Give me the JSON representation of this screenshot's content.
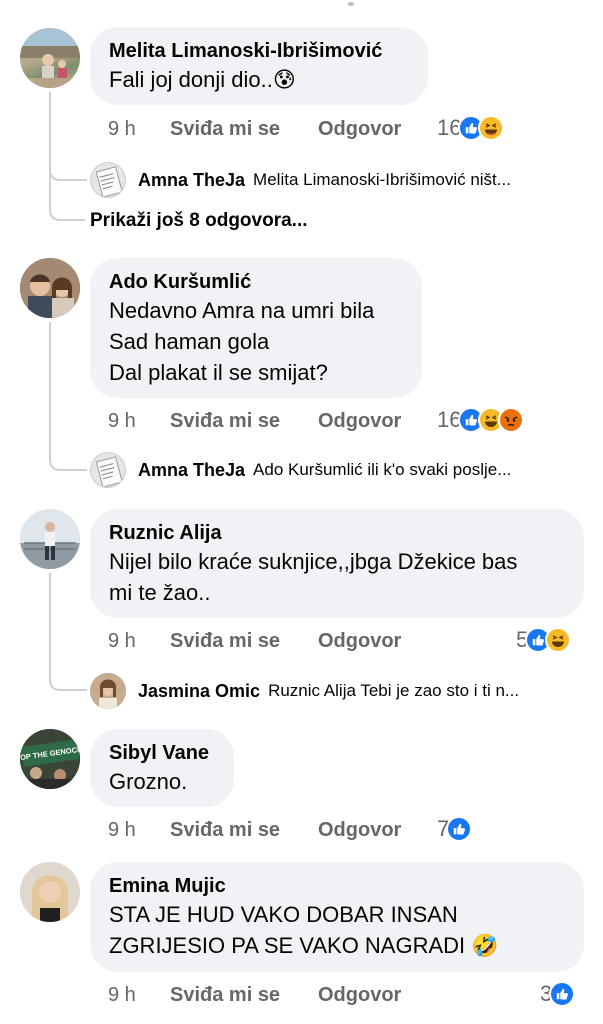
{
  "comments": [
    {
      "author": "Melita Limanoski-Ibrišimović",
      "text": "Fali joj donji dio..",
      "time": "9 h",
      "like_label": "Sviđa mi se",
      "reply_label": "Odgovor",
      "reaction_count": "16",
      "reactions": [
        "like-icon",
        "haha-icon"
      ],
      "reply": {
        "author": "Amna TheJa",
        "text": "Melita Limanoski-Ibrišimović ništ..."
      },
      "more_replies": "Prikaži još 8 odgovora..."
    },
    {
      "author": "Ado Kuršumlić",
      "text": "Nedavno Amra na umri bila\nSad haman gola\nDal plakat il se smijat?",
      "time": "9 h",
      "like_label": "Sviđa mi se",
      "reply_label": "Odgovor",
      "reaction_count": "16",
      "reactions": [
        "like-icon",
        "haha-icon",
        "angry-icon"
      ],
      "reply": {
        "author": "Amna TheJa",
        "text": "Ado Kuršumlić ili k'o svaki poslje..."
      }
    },
    {
      "author": "Ruznic Alija",
      "text": "Nijel bilo kraće suknjice,,jbga Džekice bas\nmi te žao..",
      "time": "9 h",
      "like_label": "Sviđa mi se",
      "reply_label": "Odgovor",
      "reaction_count": "5",
      "reactions": [
        "like-icon",
        "haha-icon"
      ],
      "reply": {
        "author": "Jasmina Omic",
        "text": "Ruznic Alija Tebi je zao sto i ti n..."
      }
    },
    {
      "author": "Sibyl Vane",
      "text": "Grozno.",
      "time": "9 h",
      "like_label": "Sviđa mi se",
      "reply_label": "Odgovor",
      "reaction_count": "7",
      "reactions": [
        "like-icon"
      ],
      "avatar_text": "STOP THE GENOCIDE"
    },
    {
      "author": "Emina Mujic",
      "text": "STA JE HUD VAKO DOBAR INSAN\nZGRIJESIO PA SE VAKO NAGRADI",
      "time": "9 h",
      "like_label": "Sviđa mi se",
      "reply_label": "Odgovor",
      "reaction_count": "3",
      "reactions": [
        "like-icon"
      ]
    }
  ],
  "emojis": {
    "comment1": "😰",
    "comment5": "🤣"
  },
  "colors": {
    "bubble": "#f0f2f5",
    "secondary_text": "#65676b",
    "like": "#1877f2",
    "haha": "#f7b928",
    "angry": "#e9710f",
    "thread_line": "#ced0d4"
  }
}
